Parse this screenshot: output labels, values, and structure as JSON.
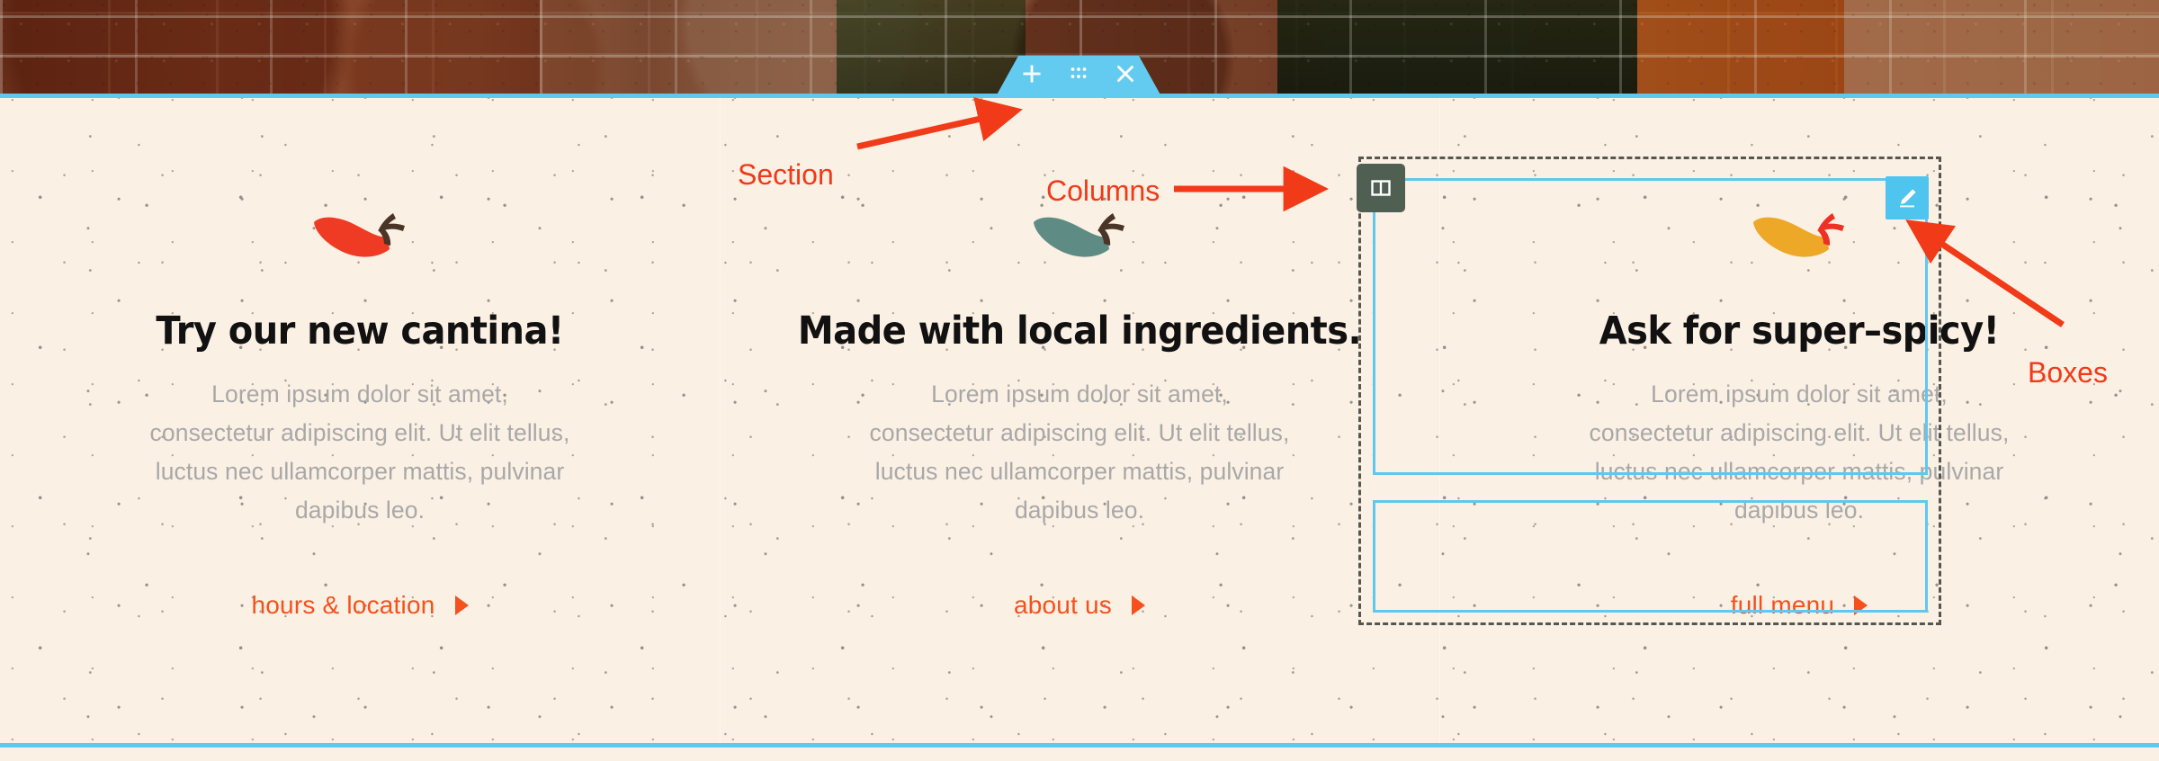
{
  "editor": {
    "section_toolbar": {
      "add_label": "+",
      "icons": [
        "plus-icon",
        "drag-handle-icon",
        "close-icon"
      ]
    },
    "columns_badge_icon": "columns-icon",
    "edit_button_icon": "pencil-icon",
    "accent_blue": "#5ec8ef",
    "badge_green": "#4f5f52",
    "outline_dash_color": "#55564f"
  },
  "annotations": {
    "color": "#f03a18",
    "items": [
      {
        "label": "Section"
      },
      {
        "label": "Columns"
      },
      {
        "label": "Boxes"
      }
    ]
  },
  "page": {
    "background_color": "#fbf0e4",
    "heading_color": "#111111",
    "body_color": "#a8a8a8",
    "link_color": "#f4511e",
    "columns": [
      {
        "pepper_icon": "chili-pepper-icon",
        "pepper_color": "#ef3b24",
        "pepper_stem_color": "#4a3526",
        "title": "Try our new cantina!",
        "body": "Lorem ipsum dolor sit amet, consectetur adipiscing elit. Ut elit tellus, luctus nec ullamcorper mattis, pulvinar dapibus leo.",
        "link": "hours & location"
      },
      {
        "pepper_icon": "chili-pepper-icon",
        "pepper_color": "#5e8c84",
        "pepper_stem_color": "#4a3526",
        "title": "Made with local ingredients.",
        "body": "Lorem ipsum dolor sit amet, consectetur adipiscing elit. Ut elit tellus, luctus nec ullamcorper mattis, pulvinar dapibus leo.",
        "link": "about us"
      },
      {
        "pepper_icon": "chili-pepper-icon",
        "pepper_color": "#eda828",
        "pepper_stem_color": "#ee3124",
        "title": "Ask for super–spicy!",
        "body": "Lorem ipsum dolor sit amet, consectetur adipiscing elit. Ut elit tellus, luctus nec ullamcorper mattis, pulvinar dapibus leo.",
        "link": "full menu"
      }
    ]
  }
}
